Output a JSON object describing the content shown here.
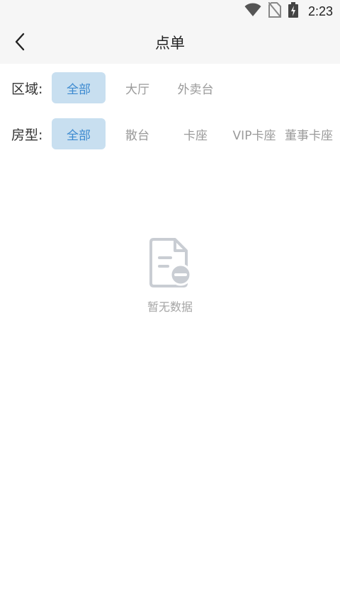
{
  "status_bar": {
    "time": "2:23",
    "icons": [
      "wifi-icon",
      "no-sim-icon",
      "battery-charging-icon"
    ]
  },
  "header": {
    "back_icon": "chevron-left-icon",
    "title": "点单"
  },
  "filters": {
    "area": {
      "label": "区域:",
      "options": [
        "全部",
        "大厅",
        "外卖台"
      ],
      "selected": "全部"
    },
    "room_type": {
      "label": "房型:",
      "options": [
        "全部",
        "散台",
        "卡座",
        "VIP卡座",
        "董事卡座"
      ],
      "selected": "全部"
    }
  },
  "empty_state": {
    "icon": "empty-document-icon",
    "text": "暂无数据"
  },
  "colors": {
    "accent": "#3c8ad0",
    "chip_active_bg": "#c8dff0",
    "muted_text": "#9a9a9a",
    "header_bg": "#f6f6f6"
  }
}
